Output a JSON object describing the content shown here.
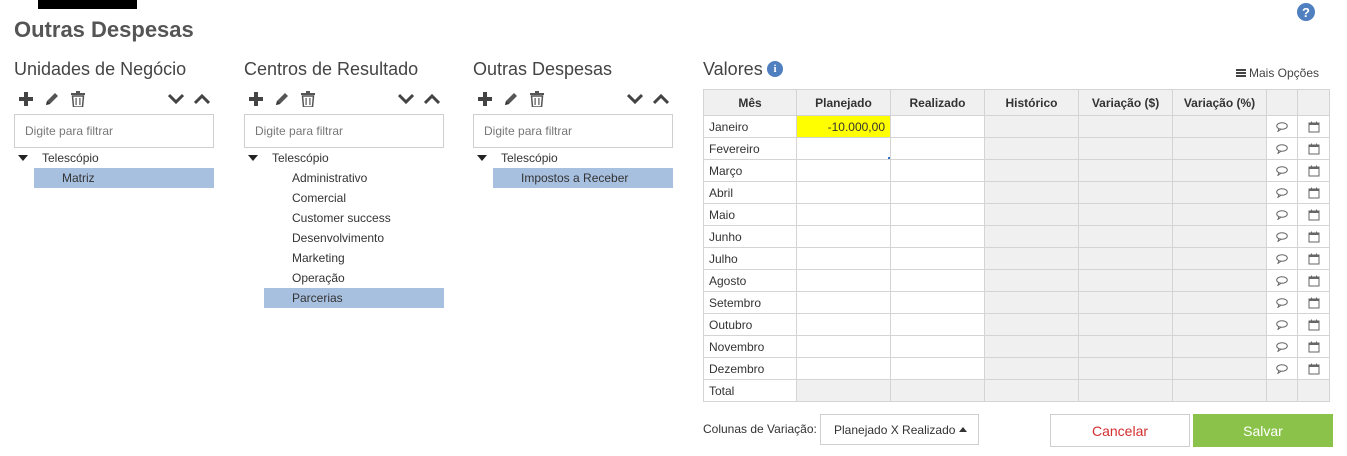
{
  "page": {
    "title": "Outras Despesas",
    "help_icon": "question-circle-icon",
    "help_glyph": "?"
  },
  "panels": [
    {
      "title": "Unidades de Negócio",
      "filter_placeholder": "Digite para filtrar",
      "tree": {
        "root": "Telescópio",
        "items": [
          "Matriz"
        ],
        "selected_index": 0
      }
    },
    {
      "title": "Centros de Resultado",
      "filter_placeholder": "Digite para filtrar",
      "tree": {
        "root": "Telescópio",
        "items": [
          "Administrativo",
          "Comercial",
          "Customer success",
          "Desenvolvimento",
          "Marketing",
          "Operação",
          "Parcerias"
        ],
        "selected_index": 6
      }
    },
    {
      "title": "Outras Despesas",
      "filter_placeholder": "Digite para filtrar",
      "tree": {
        "root": "Telescópio",
        "items": [
          "Impostos a Receber"
        ],
        "selected_index": 0
      }
    }
  ],
  "toolbar_icons": [
    "plus-icon",
    "pencil-icon",
    "trash-icon",
    "chevron-down-icon",
    "chevron-up-icon"
  ],
  "valores": {
    "title": "Valores",
    "info_glyph": "i",
    "mais_opcoes": "Mais Opções",
    "columns": [
      "Mês",
      "Planejado",
      "Realizado",
      "Histórico",
      "Variação ($)",
      "Variação (%)",
      "",
      ""
    ],
    "rows": [
      {
        "mes": "Janeiro",
        "planejado": "-10.000,00"
      },
      {
        "mes": "Fevereiro",
        "planejado": ""
      },
      {
        "mes": "Março",
        "planejado": ""
      },
      {
        "mes": "Abril",
        "planejado": ""
      },
      {
        "mes": "Maio",
        "planejado": ""
      },
      {
        "mes": "Junho",
        "planejado": ""
      },
      {
        "mes": "Julho",
        "planejado": ""
      },
      {
        "mes": "Agosto",
        "planejado": ""
      },
      {
        "mes": "Setembro",
        "planejado": ""
      },
      {
        "mes": "Outubro",
        "planejado": ""
      },
      {
        "mes": "Novembro",
        "planejado": ""
      },
      {
        "mes": "Dezembro",
        "planejado": ""
      }
    ],
    "total_label": "Total",
    "highlight_color": "#ffff00"
  },
  "footer": {
    "variacao_label": "Colunas de Variação:",
    "variacao_value": "Planejado X Realizado",
    "cancel_label": "Cancelar",
    "save_label": "Salvar",
    "save_color": "#8bc34a",
    "cancel_color": "#d32f2f"
  }
}
